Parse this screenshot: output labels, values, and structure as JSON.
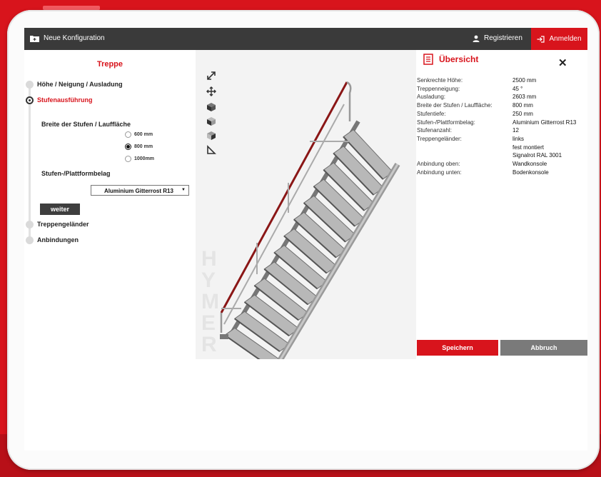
{
  "colors": {
    "accent": "#d8141c",
    "topbar": "#3a3a3a",
    "rail": "#8a1616"
  },
  "topbar": {
    "new_config": "Neue Konfiguration",
    "new_config_icon": "folder-plus-icon",
    "register": "Registrieren",
    "register_icon": "user-icon",
    "login": "Anmelden",
    "login_icon": "login-arrow-icon"
  },
  "config": {
    "title": "Treppe",
    "steps": [
      {
        "label": "Höhe / Neigung / Ausladung"
      },
      {
        "label": "Stufenausführung"
      },
      {
        "label": "Treppengeländer"
      },
      {
        "label": "Anbindungen"
      }
    ],
    "width_label": "Breite der Stufen / Lauffläche",
    "width_options": [
      "600 mm",
      "800 mm",
      "1000mm"
    ],
    "width_selected": "800 mm",
    "covering_label": "Stufen-/Plattformbelag",
    "covering_value": "Aluminium Gitterrost R13",
    "next_button": "weiter"
  },
  "viewer": {
    "tools": [
      "fullscreen-icon",
      "move-icon",
      "cube-front-icon",
      "cube-side-icon",
      "cube-iso-icon",
      "angle-icon"
    ],
    "brand": [
      "H",
      "Y",
      "M",
      "E",
      "R"
    ],
    "stair_steps": 13
  },
  "overview": {
    "title": "Übersicht",
    "title_icon": "document-icon",
    "rows": [
      {
        "label": "Senkrechte Höhe:",
        "value": "2500 mm"
      },
      {
        "label": "Treppenneigung:",
        "value": "45 °"
      },
      {
        "label": "Ausladung:",
        "value": "2603 mm"
      },
      {
        "label": "Breite der Stufen / Lauffläche:",
        "value": "800 mm"
      },
      {
        "label": "Stufentiefe:",
        "value": "250 mm"
      },
      {
        "label": "Stufen-/Plattformbelag:",
        "value": "Aluminium Gitterrost R13"
      },
      {
        "label": "Stufenanzahl:",
        "value": "12"
      },
      {
        "label": "Treppengeländer:",
        "value": "links"
      },
      {
        "label": "",
        "value": "fest montiert"
      },
      {
        "label": "",
        "value": "Signalrot RAL 3001"
      },
      {
        "label": "Anbindung oben:",
        "value": "Wandkonsole"
      },
      {
        "label": "Anbindung unten:",
        "value": "Bodenkonsole"
      }
    ],
    "save": "Speichern",
    "cancel": "Abbruch"
  }
}
